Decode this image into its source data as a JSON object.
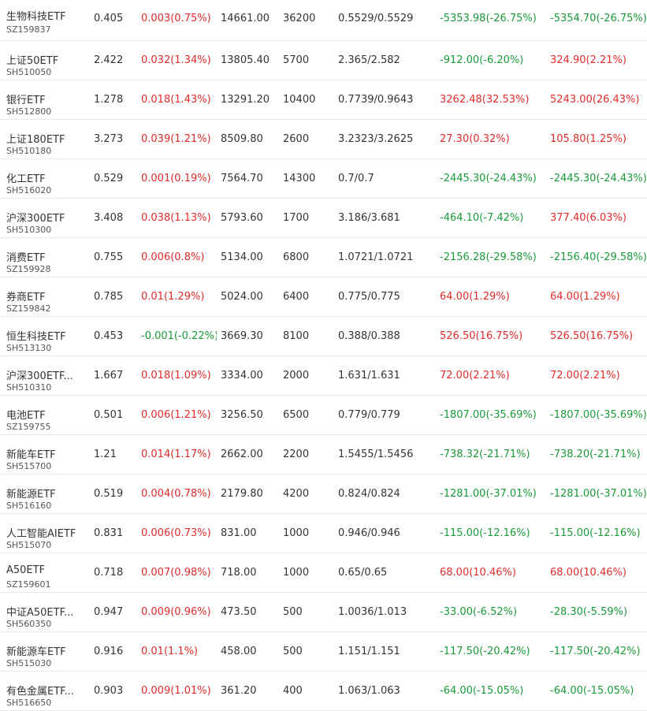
{
  "colors": {
    "up": "#e12b2b",
    "down": "#1a9a3a",
    "text": "#333333",
    "border": "#e8e8e8"
  },
  "rows": [
    {
      "name": "生物科技ETF",
      "code": "SZ159837",
      "price": "0.405",
      "change": "0.003(0.75%)",
      "change_dir": "up",
      "amount": "14661.00",
      "shares": "36200",
      "cost": "0.5529/0.5529",
      "pnl": "-5353.98(-26.75%)",
      "pnl_dir": "down",
      "day_pnl": "-5354.70(-26.75%)",
      "day_pnl_dir": "down"
    },
    {
      "name": "上证50ETF",
      "code": "SH510050",
      "price": "2.422",
      "change": "0.032(1.34%)",
      "change_dir": "up",
      "amount": "13805.40",
      "shares": "5700",
      "cost": "2.365/2.582",
      "pnl": "-912.00(-6.20%)",
      "pnl_dir": "down",
      "day_pnl": "324.90(2.21%)",
      "day_pnl_dir": "up"
    },
    {
      "name": "银行ETF",
      "code": "SH512800",
      "price": "1.278",
      "change": "0.018(1.43%)",
      "change_dir": "up",
      "amount": "13291.20",
      "shares": "10400",
      "cost": "0.7739/0.9643",
      "pnl": "3262.48(32.53%)",
      "pnl_dir": "up",
      "day_pnl": "5243.00(26.43%)",
      "day_pnl_dir": "up"
    },
    {
      "name": "上证180ETF",
      "code": "SH510180",
      "price": "3.273",
      "change": "0.039(1.21%)",
      "change_dir": "up",
      "amount": "8509.80",
      "shares": "2600",
      "cost": "3.2323/3.2625",
      "pnl": "27.30(0.32%)",
      "pnl_dir": "up",
      "day_pnl": "105.80(1.25%)",
      "day_pnl_dir": "up"
    },
    {
      "name": "化工ETF",
      "code": "SH516020",
      "price": "0.529",
      "change": "0.001(0.19%)",
      "change_dir": "up",
      "amount": "7564.70",
      "shares": "14300",
      "cost": "0.7/0.7",
      "pnl": "-2445.30(-24.43%)",
      "pnl_dir": "down",
      "day_pnl": "-2445.30(-24.43%)",
      "day_pnl_dir": "down"
    },
    {
      "name": "沪深300ETF",
      "code": "SH510300",
      "price": "3.408",
      "change": "0.038(1.13%)",
      "change_dir": "up",
      "amount": "5793.60",
      "shares": "1700",
      "cost": "3.186/3.681",
      "pnl": "-464.10(-7.42%)",
      "pnl_dir": "down",
      "day_pnl": "377.40(6.03%)",
      "day_pnl_dir": "up"
    },
    {
      "name": "消费ETF",
      "code": "SZ159928",
      "price": "0.755",
      "change": "0.006(0.8%)",
      "change_dir": "up",
      "amount": "5134.00",
      "shares": "6800",
      "cost": "1.0721/1.0721",
      "pnl": "-2156.28(-29.58%)",
      "pnl_dir": "down",
      "day_pnl": "-2156.40(-29.58%)",
      "day_pnl_dir": "down"
    },
    {
      "name": "券商ETF",
      "code": "SZ159842",
      "price": "0.785",
      "change": "0.01(1.29%)",
      "change_dir": "up",
      "amount": "5024.00",
      "shares": "6400",
      "cost": "0.775/0.775",
      "pnl": "64.00(1.29%)",
      "pnl_dir": "up",
      "day_pnl": "64.00(1.29%)",
      "day_pnl_dir": "up"
    },
    {
      "name": "恒生科技ETF",
      "code": "SH513130",
      "price": "0.453",
      "change": "-0.001(-0.22%)",
      "change_dir": "down",
      "amount": "3669.30",
      "shares": "8100",
      "cost": "0.388/0.388",
      "pnl": "526.50(16.75%)",
      "pnl_dir": "up",
      "day_pnl": "526.50(16.75%)",
      "day_pnl_dir": "up"
    },
    {
      "name": "沪深300ETF...",
      "code": "SH510310",
      "price": "1.667",
      "change": "0.018(1.09%)",
      "change_dir": "up",
      "amount": "3334.00",
      "shares": "2000",
      "cost": "1.631/1.631",
      "pnl": "72.00(2.21%)",
      "pnl_dir": "up",
      "day_pnl": "72.00(2.21%)",
      "day_pnl_dir": "up"
    },
    {
      "name": "电池ETF",
      "code": "SZ159755",
      "price": "0.501",
      "change": "0.006(1.21%)",
      "change_dir": "up",
      "amount": "3256.50",
      "shares": "6500",
      "cost": "0.779/0.779",
      "pnl": "-1807.00(-35.69%)",
      "pnl_dir": "down",
      "day_pnl": "-1807.00(-35.69%)",
      "day_pnl_dir": "down"
    },
    {
      "name": "新能车ETF",
      "code": "SH515700",
      "price": "1.21",
      "change": "0.014(1.17%)",
      "change_dir": "up",
      "amount": "2662.00",
      "shares": "2200",
      "cost": "1.5455/1.5456",
      "pnl": "-738.32(-21.71%)",
      "pnl_dir": "down",
      "day_pnl": "-738.20(-21.71%)",
      "day_pnl_dir": "down"
    },
    {
      "name": "新能源ETF",
      "code": "SH516160",
      "price": "0.519",
      "change": "0.004(0.78%)",
      "change_dir": "up",
      "amount": "2179.80",
      "shares": "4200",
      "cost": "0.824/0.824",
      "pnl": "-1281.00(-37.01%)",
      "pnl_dir": "down",
      "day_pnl": "-1281.00(-37.01%)",
      "day_pnl_dir": "down"
    },
    {
      "name": "人工智能AIETF",
      "code": "SH515070",
      "price": "0.831",
      "change": "0.006(0.73%)",
      "change_dir": "up",
      "amount": "831.00",
      "shares": "1000",
      "cost": "0.946/0.946",
      "pnl": "-115.00(-12.16%)",
      "pnl_dir": "down",
      "day_pnl": "-115.00(-12.16%)",
      "day_pnl_dir": "down"
    },
    {
      "name": "A50ETF",
      "code": "SZ159601",
      "price": "0.718",
      "change": "0.007(0.98%)",
      "change_dir": "up",
      "amount": "718.00",
      "shares": "1000",
      "cost": "0.65/0.65",
      "pnl": "68.00(10.46%)",
      "pnl_dir": "up",
      "day_pnl": "68.00(10.46%)",
      "day_pnl_dir": "up"
    },
    {
      "name": "中证A50ETF...",
      "code": "SH560350",
      "price": "0.947",
      "change": "0.009(0.96%)",
      "change_dir": "up",
      "amount": "473.50",
      "shares": "500",
      "cost": "1.0036/1.013",
      "pnl": "-33.00(-6.52%)",
      "pnl_dir": "down",
      "day_pnl": "-28.30(-5.59%)",
      "day_pnl_dir": "down"
    },
    {
      "name": "新能源车ETF",
      "code": "SH515030",
      "price": "0.916",
      "change": "0.01(1.1%)",
      "change_dir": "up",
      "amount": "458.00",
      "shares": "500",
      "cost": "1.151/1.151",
      "pnl": "-117.50(-20.42%)",
      "pnl_dir": "down",
      "day_pnl": "-117.50(-20.42%)",
      "day_pnl_dir": "down"
    },
    {
      "name": "有色金属ETF...",
      "code": "SH516650",
      "price": "0.903",
      "change": "0.009(1.01%)",
      "change_dir": "up",
      "amount": "361.20",
      "shares": "400",
      "cost": "1.063/1.063",
      "pnl": "-64.00(-15.05%)",
      "pnl_dir": "down",
      "day_pnl": "-64.00(-15.05%)",
      "day_pnl_dir": "down"
    }
  ]
}
